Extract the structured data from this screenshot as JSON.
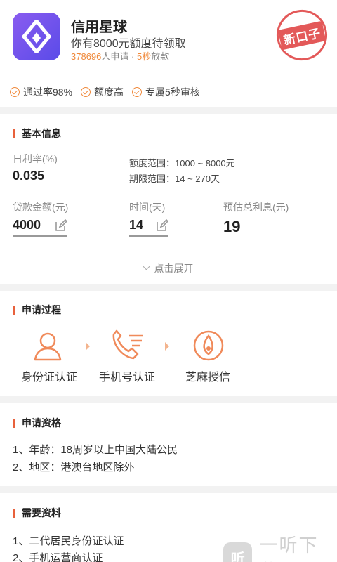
{
  "app": {
    "name": "信用星球",
    "subtitle": "你有8000元额度待领取",
    "applicants_count": "378696",
    "applicants_suffix": "人申请 · ",
    "loan_speed": "5秒",
    "loan_speed_suffix": "放款",
    "stamp_text": "新口子",
    "brand_color": "#6a50ec",
    "accent_color": "#f08a3c"
  },
  "features": [
    "通过率98%",
    "额度高",
    "专属5秒审核"
  ],
  "basic": {
    "title": "基本信息",
    "rate_label": "日利率(%)",
    "rate_value": "0.035",
    "limit_range": "额度范围：1000 ~ 8000元",
    "term_range": "期限范围：14 ~ 270天",
    "amount_label": "贷款金额(元)",
    "amount_value": "4000",
    "term_label": "时间(天)",
    "term_value": "14",
    "interest_label": "预估总利息(元)",
    "interest_value": "19",
    "expand_label": "点击展开"
  },
  "process": {
    "title": "申请过程",
    "steps": [
      {
        "label": "身份证认证",
        "icon": "person-icon"
      },
      {
        "label": "手机号认证",
        "icon": "phone-icon"
      },
      {
        "label": "芝麻授信",
        "icon": "sesame-icon"
      }
    ]
  },
  "qualification": {
    "title": "申请资格",
    "items": [
      "1、年龄：18周岁以上中国大陆公民",
      "2、地区：港澳台地区除外"
    ]
  },
  "materials": {
    "title": "需要资料",
    "items": [
      "1、二代居民身份证认证",
      "2、手机运营商认证"
    ]
  },
  "watermark": {
    "badge": "听",
    "text": "一听下载"
  }
}
